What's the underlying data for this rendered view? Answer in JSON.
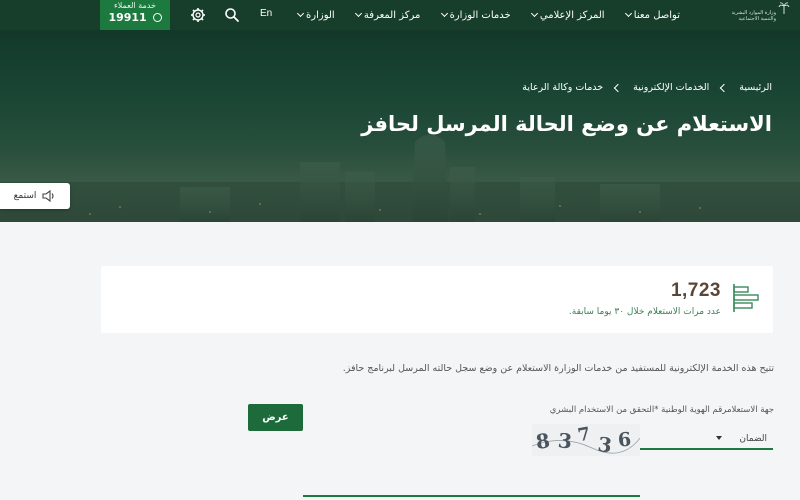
{
  "colors": {
    "nav_bg": "#173d2b",
    "accent_green": "#1d7a3e",
    "button_green": "#1d6b3a",
    "stat_number": "#5a4636",
    "page_bg": "#f4f5f6"
  },
  "topnav": {
    "logo_text": "وزارة الموارد البشرية والتنمية الاجتماعية",
    "hotline_label": "خدمة العملاء",
    "hotline_number": "19911",
    "lang": "En",
    "menu": [
      {
        "label": "الوزارة",
        "dropdown": true
      },
      {
        "label": "مركز المعرفة",
        "dropdown": true
      },
      {
        "label": "خدمات الوزارة",
        "dropdown": true
      },
      {
        "label": "المركز الإعلامي",
        "dropdown": true
      },
      {
        "label": "تواصل معنا",
        "dropdown": true
      }
    ],
    "icons": [
      "gear-icon",
      "search-icon",
      "phone-icon"
    ]
  },
  "hero": {
    "breadcrumb": [
      "الرئيسية",
      "الخدمات الإلكترونية",
      "خدمات وكالة الرعاية"
    ],
    "title": "الاستعلام عن وضع الحالة المرسل لحافز",
    "listen_label": "استمع"
  },
  "stats": {
    "count": "1,723",
    "description": "عدد مرات الاستعلام خلال ٣٠ يوما سابقة."
  },
  "service": {
    "description": "تتيح هذه الخدمة الإلكترونية للمستفيد من خدمات الوزارة الاستعلام عن وضع سجل حالته المرسل لبرنامج حافز."
  },
  "form": {
    "label": "جهة الاستعلامرقم الهوية الوطنية *التحقق من الاستخدام البشري",
    "select_value": "الضمان",
    "captcha_digits": [
      "8",
      "3",
      "7",
      "3",
      "6"
    ],
    "submit_label": "عرض"
  }
}
